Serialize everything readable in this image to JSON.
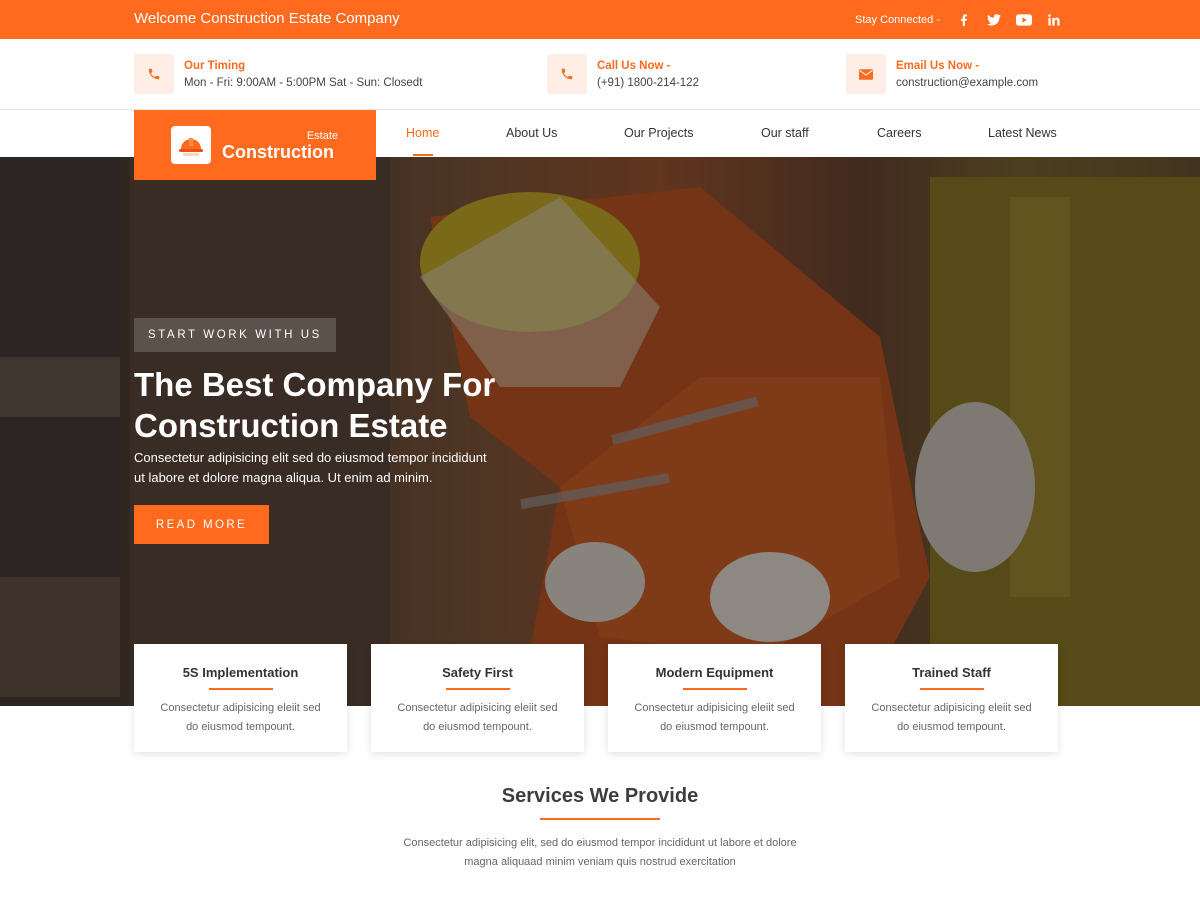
{
  "topbar": {
    "welcome": "Welcome Construction Estate Company",
    "stay_connected": "Stay Connected -",
    "social": [
      "facebook-icon",
      "twitter-icon",
      "youtube-icon",
      "linkedin-icon"
    ]
  },
  "info": {
    "timing": {
      "title": "Our Timing",
      "value": "Mon - Fri: 9:00AM - 5:00PM  Sat - Sun: Closedt",
      "icon": "phone-icon"
    },
    "call": {
      "title": "Call Us Now -",
      "value": "(+91) 1800-214-122",
      "icon": "phone-icon"
    },
    "email": {
      "title": "Email Us Now -",
      "value": "construction@example.com",
      "icon": "envelope-icon"
    }
  },
  "logo": {
    "small": "Estate",
    "big": "Construction",
    "icon": "hard-hat-icon"
  },
  "nav": {
    "items": [
      "Home",
      "About Us",
      "Our Projects",
      "Our staff",
      "Careers",
      "Latest News"
    ],
    "active": "Home"
  },
  "hero": {
    "badge": "START WORK WITH US",
    "headline_1": "The Best Company For",
    "headline_2": "Construction Estate",
    "para_1": "Consectetur adipisicing elit sed do eiusmod tempor incididunt",
    "para_2": "ut labore et dolore magna aliqua. Ut enim ad minim.",
    "cta": "READ MORE"
  },
  "features": [
    {
      "title": "5S Implementation",
      "text_1": "Consectetur adipisicing eleiit sed",
      "text_2": "do eiusmod tempount."
    },
    {
      "title": "Safety First",
      "text_1": "Consectetur adipisicing eleiit sed",
      "text_2": "do eiusmod tempount."
    },
    {
      "title": "Modern Equipment",
      "text_1": "Consectetur adipisicing eleiit sed",
      "text_2": "do eiusmod tempount."
    },
    {
      "title": "Trained Staff",
      "text_1": "Consectetur adipisicing eleiit sed",
      "text_2": "do eiusmod tempount."
    }
  ],
  "services": {
    "title": "Services We Provide",
    "text_1": "Consectetur adipisicing elit, sed do eiusmod tempor incididunt ut labore et dolore",
    "text_2": "magna aliquaad minim veniam quis nostrud exercitation"
  },
  "colors": {
    "accent": "#ff6a1f",
    "accent_light": "#ffeee5",
    "heading": "#3d3d3d"
  }
}
